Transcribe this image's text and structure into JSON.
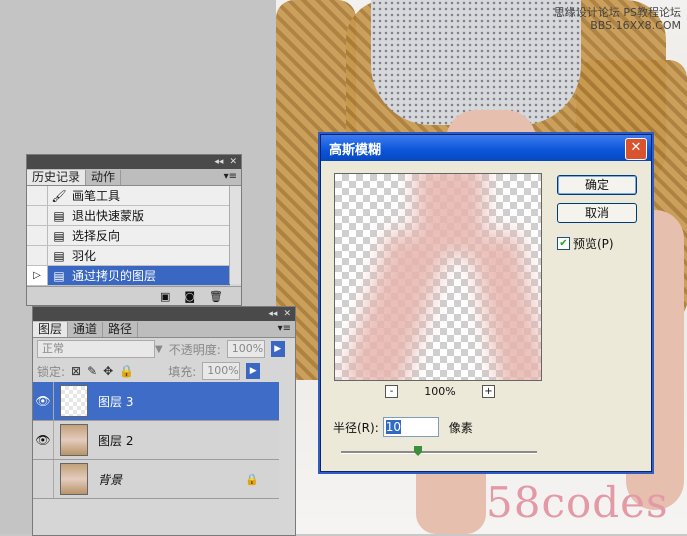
{
  "watermark": {
    "top_line1": "思缘设计论坛",
    "top_line2": "PS教程论坛",
    "top_line3": "BBS.16XX8.COM",
    "bottom": "58codes"
  },
  "history_panel": {
    "tabs": [
      "历史记录",
      "动作"
    ],
    "items": [
      {
        "label": "画笔工具",
        "icon": "brush-icon"
      },
      {
        "label": "退出快速蒙版",
        "icon": "doc-icon"
      },
      {
        "label": "选择反向",
        "icon": "doc-icon"
      },
      {
        "label": "羽化",
        "icon": "doc-icon"
      },
      {
        "label": "通过拷贝的图层",
        "icon": "doc-icon",
        "selected": true
      }
    ]
  },
  "layers_panel": {
    "tabs": [
      "图层",
      "通道",
      "路径"
    ],
    "blend_mode": "正常",
    "opacity_label": "不透明度:",
    "opacity_value": "100%",
    "lock_label": "锁定:",
    "fill_label": "填充:",
    "fill_value": "100%",
    "layers": [
      {
        "name": "图层 3",
        "visible": true,
        "selected": true,
        "thumb": "transparent"
      },
      {
        "name": "图层 2",
        "visible": true,
        "selected": false,
        "thumb": "photo"
      },
      {
        "name": "背景",
        "visible": false,
        "selected": false,
        "thumb": "photo",
        "locked": true
      }
    ]
  },
  "dialog": {
    "title": "高斯模糊",
    "ok_label": "确定",
    "cancel_label": "取消",
    "preview_label": "预览(P)",
    "preview_checked": true,
    "zoom_minus": "-",
    "zoom_value": "100%",
    "zoom_plus": "+",
    "radius_label": "半径(R):",
    "radius_value": "10",
    "radius_unit": "像素",
    "close_label": "✕"
  }
}
